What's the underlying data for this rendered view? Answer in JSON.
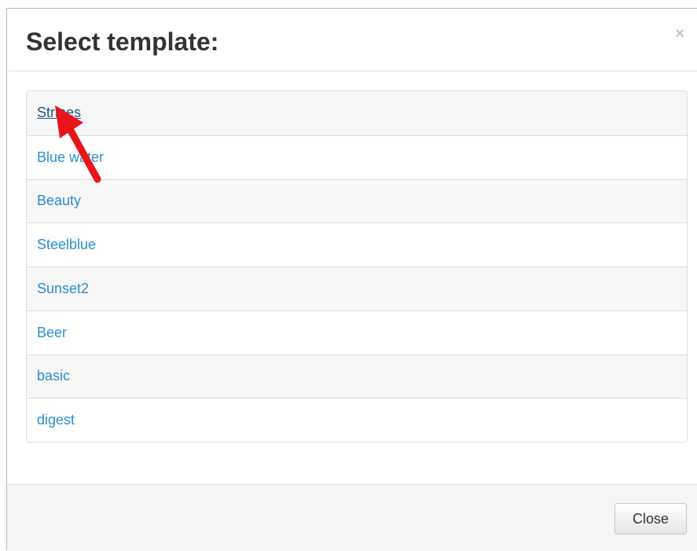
{
  "dialog": {
    "title": "Select template:",
    "close_icon": "×",
    "close_button_label": "Close"
  },
  "templates": [
    {
      "label": "Stripes",
      "hovered": true
    },
    {
      "label": "Blue water"
    },
    {
      "label": "Beauty"
    },
    {
      "label": "Steelblue"
    },
    {
      "label": "Sunset2"
    },
    {
      "label": "Beer"
    },
    {
      "label": "basic"
    },
    {
      "label": "digest"
    }
  ],
  "colors": {
    "link": "#2a8fcf",
    "link_hover": "#1b5a8a",
    "annotation_arrow": "#e8151b"
  },
  "icons": {
    "close": "close-icon",
    "annotation": "red-arrow-icon"
  }
}
